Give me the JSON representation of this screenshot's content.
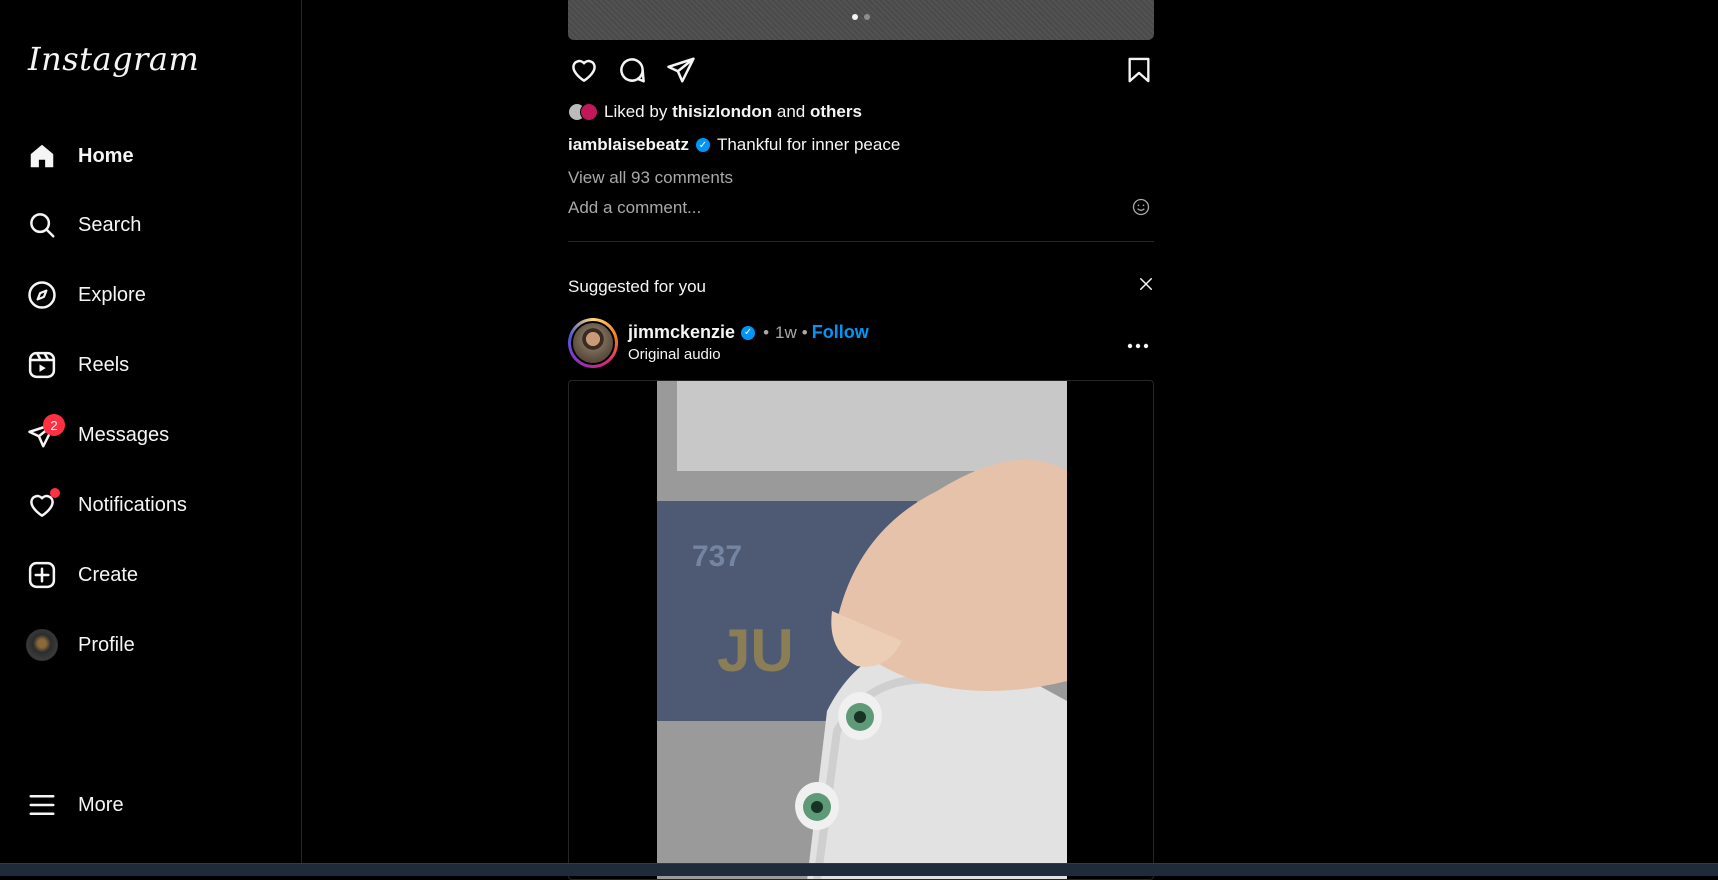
{
  "sidebar": {
    "logo": "Instagram",
    "items": [
      {
        "label": "Home",
        "icon": "home-icon",
        "active": true
      },
      {
        "label": "Search",
        "icon": "search-icon"
      },
      {
        "label": "Explore",
        "icon": "compass-icon"
      },
      {
        "label": "Reels",
        "icon": "reels-icon"
      },
      {
        "label": "Messages",
        "icon": "paper-plane-icon",
        "badge": "2"
      },
      {
        "label": "Notifications",
        "icon": "heart-icon",
        "dot": true
      },
      {
        "label": "Create",
        "icon": "plus-square-icon"
      },
      {
        "label": "Profile",
        "icon": "avatar"
      }
    ],
    "more": {
      "label": "More",
      "icon": "hamburger-icon"
    }
  },
  "previous_post": {
    "carousel_dots": 2,
    "liked_by_prefix": "Liked by",
    "liked_by_user": "thisizlondon",
    "liked_by_and": "and",
    "liked_by_others": "others",
    "caption_user": "iamblaisebeatz",
    "caption_text": "Thankful for inner peace",
    "view_comments": "View all 93 comments",
    "add_comment_placeholder": "Add a comment..."
  },
  "suggested": {
    "title": "Suggested for you",
    "post": {
      "username": "jimmckenzie",
      "separator": "•",
      "time": "1w",
      "follow": "Follow",
      "audio": "Original audio"
    }
  },
  "colors": {
    "background": "#000000",
    "accent_blue": "#0095f6",
    "badge_red": "#ff3040",
    "muted_text": "#a8a8a8",
    "divider": "#262626"
  }
}
